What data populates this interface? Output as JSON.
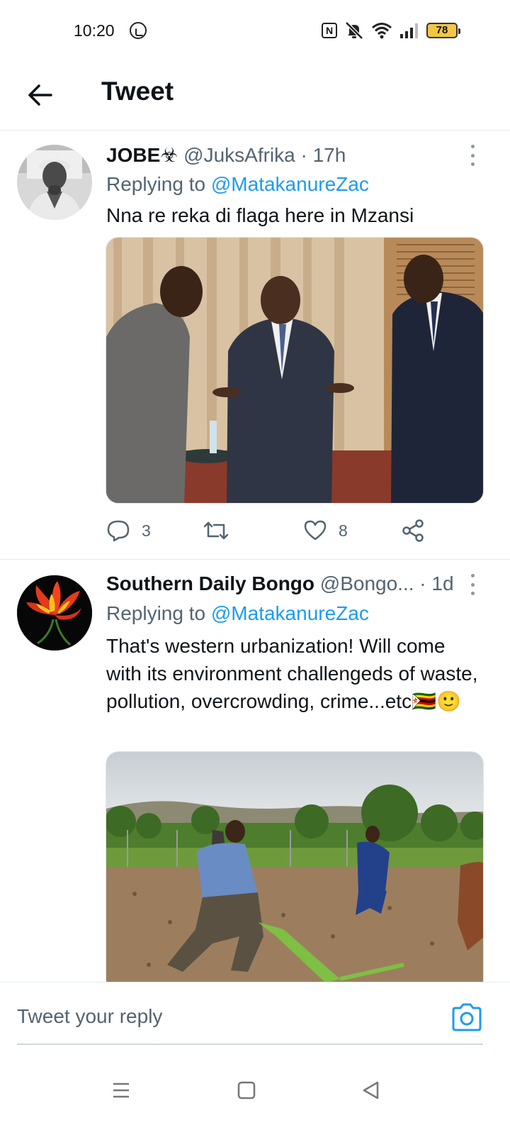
{
  "status_bar": {
    "time": "10:20",
    "battery": "78",
    "icons": [
      "whatsapp-icon",
      "nfc-icon",
      "mute-icon",
      "wifi-icon",
      "signal-icon",
      "battery-icon"
    ]
  },
  "header": {
    "back_icon": "arrow-left-icon",
    "title": "Tweet"
  },
  "tweets": [
    {
      "name": "JOBE☣",
      "handle": "@JuksAfrika",
      "separator": "·",
      "time": "17h",
      "replying_prefix": "Replying to ",
      "replying_to": "@MatakanureZac",
      "text": "Nna re reka di flaga here in Mzansi",
      "replies": "3",
      "retweets": "",
      "likes": "8"
    },
    {
      "name": "Southern Daily Bongo",
      "handle": "@Bongo...",
      "separator": "·",
      "time": "1d",
      "replying_prefix": "Replying to ",
      "replying_to": "@MatakanureZac",
      "text": "That's western urbanization! Will come with its environment challengeds of waste, pollution, overcrowding, crime...etc🇿🇼🙂"
    }
  ],
  "reply_bar": {
    "placeholder": "Tweet your reply"
  },
  "colors": {
    "accent": "#1d9bf0",
    "text_primary": "#0f1419",
    "text_secondary": "#536471",
    "divider": "#e6e9ec",
    "battery": "#f2c744"
  }
}
